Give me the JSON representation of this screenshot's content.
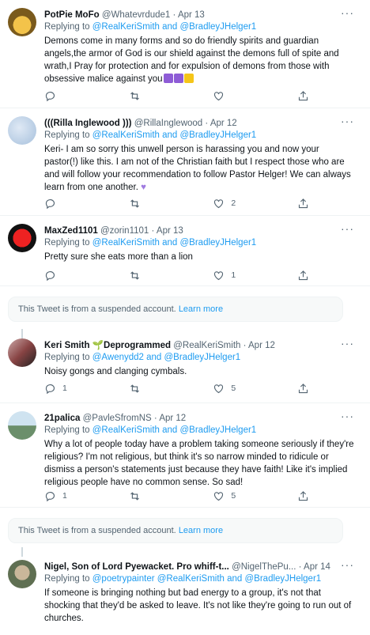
{
  "tweets": [
    {
      "name": "PotPie MoFo",
      "handle": "@Whatevrdude1",
      "date": "Apr 13",
      "reply_prefix": "Replying to",
      "reply_to": "@RealKeriSmith and @BradleyJHelger1",
      "text": "Demons come in many forms and so do friendly spirits and guardian angels,the armor of God is our shield against the demons full of spite and wrath,I Pray for protection and for expulsion of demons from those with obsessive malice against you",
      "replies": "",
      "likes": ""
    },
    {
      "name": "(((Rilla Inglewood )))",
      "handle": "@RillaInglewood",
      "date": "Apr 12",
      "reply_prefix": "Replying to",
      "reply_to": "@RealKeriSmith and @BradleyJHelger1",
      "text": "Keri- I am so sorry this unwell person is harassing you and now your pastor(!) like this. I am not of the Christian faith but I respect those who are and will follow your recommendation to follow Pastor Helger! We can always learn from one another.",
      "replies": "",
      "likes": "2"
    },
    {
      "name": "MaxZed1101",
      "handle": "@zorin1101",
      "date": "Apr 13",
      "reply_prefix": "Replying to",
      "reply_to": "@RealKeriSmith and @BradleyJHelger1",
      "text": "Pretty sure she eats more than a lion",
      "replies": "",
      "likes": "1"
    },
    {
      "name": "Keri Smith 🌱Deprogrammed",
      "handle": "@RealKeriSmith",
      "date": "Apr 12",
      "reply_prefix": "Replying to",
      "reply_to": "@Awenydd2 and @BradleyJHelger1",
      "text": "Noisy gongs and clanging cymbals.",
      "replies": "1",
      "likes": "5"
    },
    {
      "name": "21palica",
      "handle": "@PavleSfromNS",
      "date": "Apr 12",
      "reply_prefix": "Replying to",
      "reply_to": "@RealKeriSmith and @BradleyJHelger1",
      "text": "Why a lot of people today have a problem taking someone seriously if they're religious? I'm not religious, but think it's so narrow minded to ridicule or dismiss a person's statements just because they have faith! Like it's implied religious people have no common sense. So sad!",
      "replies": "1",
      "likes": "5"
    },
    {
      "name": "Nigel, Son of Lord Pyewacket. Pro whiff-t...",
      "handle": "@NigelThePu...",
      "date": "Apr 14",
      "reply_prefix": "Replying to",
      "reply_to": "@poetrypainter @RealKeriSmith and @BradleyJHelger1",
      "text": "If someone is bringing nothing but bad energy to a group, it's not that shocking that they'd be asked to leave. It's not like they're going to run out of churches.",
      "replies": "",
      "likes": ""
    }
  ],
  "suspended": {
    "text": "This Tweet is from a suspended account.",
    "link": "Learn more"
  },
  "more_label": "···",
  "dot": "·"
}
